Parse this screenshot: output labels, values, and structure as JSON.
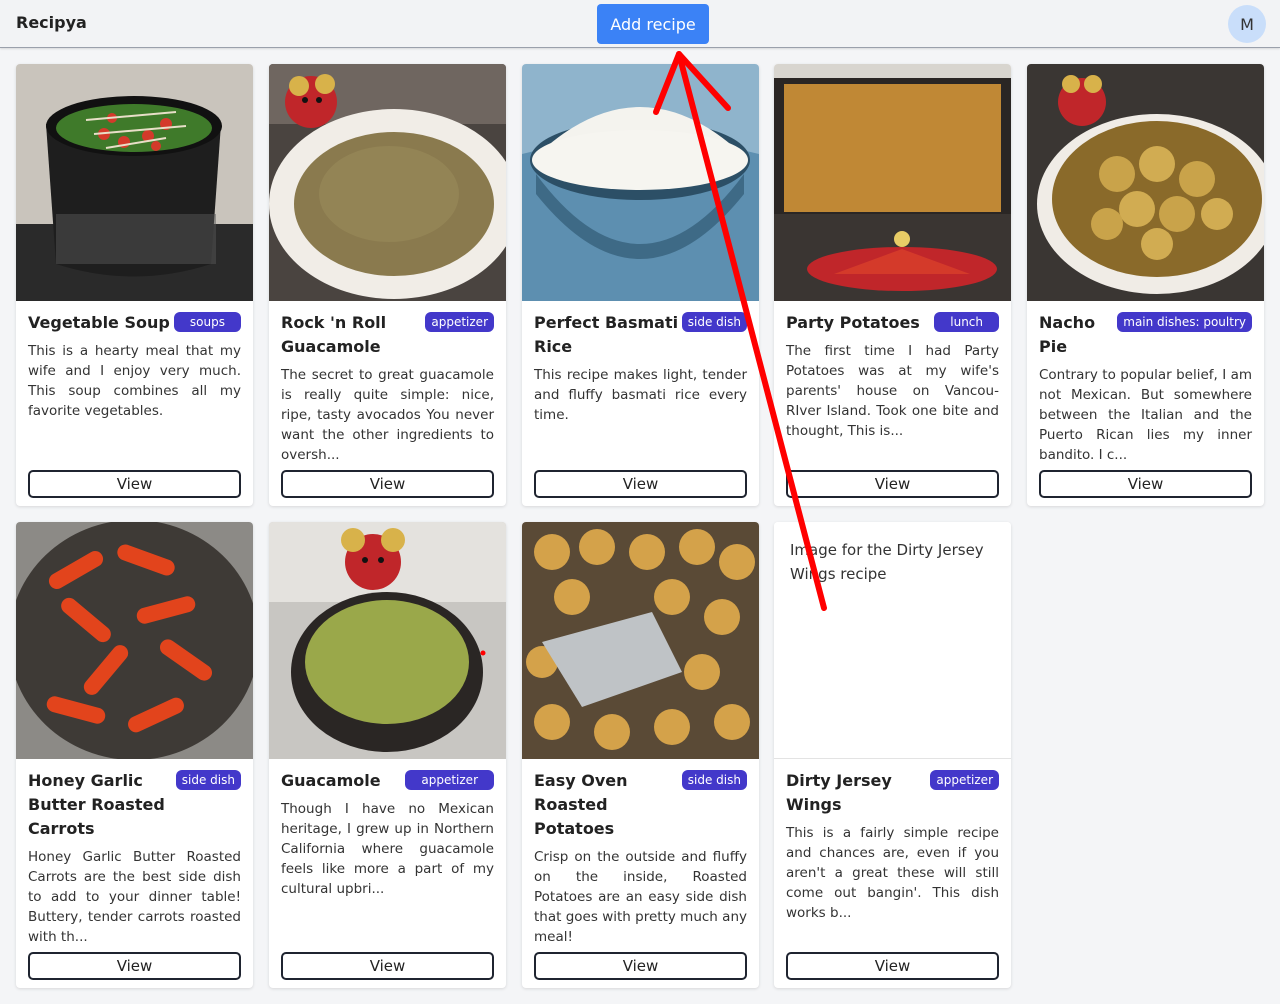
{
  "app": {
    "brand": "Recipya",
    "add_recipe_label": "Add recipe",
    "avatar_initial": "M"
  },
  "colors": {
    "accent": "#3b82f6",
    "badge": "#4338ca",
    "annotation": "#ff0000"
  },
  "recipes": [
    {
      "title": "Vegetable Soup",
      "category": "soups",
      "description": "This is a hearty meal that my wife and I enjoy very much. This soup combines all my favorite vegetables.",
      "view_label": "View"
    },
    {
      "title": "Rock 'n Roll Guacamole",
      "category": "appetizer",
      "description": "The secret to great guacamole is really quite simple: nice, ripe, tasty avocados You never want the other ingredients to oversh...",
      "view_label": "View"
    },
    {
      "title": "Perfect Basmati Rice",
      "category": "side dish",
      "description": "This recipe makes light, tender and fluffy basmati rice every time.",
      "view_label": "View"
    },
    {
      "title": "Party Potatoes",
      "category": "lunch",
      "description": "The first time I had Party Potatoes was at my wife's parents' house on Vancou- RIver Island. Took one bite and thought, This is...",
      "view_label": "View"
    },
    {
      "title": "Nacho Pie",
      "category": "main dishes: poultry",
      "description": "Contrary to popular belief, I am not Mexican. But somewhere between the Italian and the Puerto Rican lies my inner bandito. I c...",
      "view_label": "View"
    },
    {
      "title": "Honey Garlic Butter Roasted Carrots",
      "category": "side dish",
      "description": "Honey Garlic Butter Roasted Carrots are the best side dish to add to your dinner table! Buttery, tender carrots roasted with th...",
      "view_label": "View"
    },
    {
      "title": "Guacamole",
      "category": "appetizer",
      "description": "Though I have no Mexican heritage, I grew up in Northern California where guacamole feels like more a part of my cultural upbri...",
      "view_label": "View"
    },
    {
      "title": "Easy Oven Roasted Potatoes",
      "category": "side dish",
      "description": "Crisp on the outside and fluffy on the inside, Roasted Potatoes are an easy side dish that goes with pretty much any meal!",
      "view_label": "View"
    },
    {
      "title": "Dirty Jersey Wings",
      "category": "appetizer",
      "image_alt": "Image for the Dirty Jersey Wings recipe",
      "description": "This is a fairly simple recipe and chances are, even if you aren't a great these will still come out bangin'. This dish works b...",
      "view_label": "View"
    }
  ]
}
